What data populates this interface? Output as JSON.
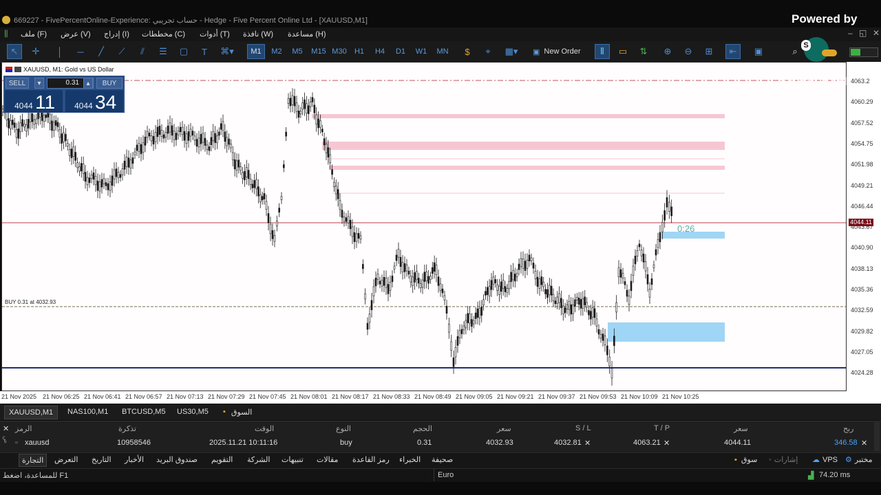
{
  "window": {
    "title": "669227 - FivePercentOnline-Experience: حساب تجريبي - Hedge - Five Percent Online Ltd - [XAUUSD,M1]",
    "overlay_powered": "Powered by",
    "overlay_brand": "StreamYard"
  },
  "menu": [
    {
      "label": "ملف (F)"
    },
    {
      "label": "عرض (V)"
    },
    {
      "label": "إدراج (I)"
    },
    {
      "label": "مخططات (C)"
    },
    {
      "label": "أدوات (T)"
    },
    {
      "label": "نافذة (W)"
    },
    {
      "label": "مساعدة (H)"
    }
  ],
  "toolbar": {
    "timeframes": [
      "M1",
      "M2",
      "M5",
      "M15",
      "M30",
      "H1",
      "H4",
      "D1",
      "W1",
      "MN"
    ],
    "selected_timeframe": "M1",
    "new_order": "New Order"
  },
  "chart": {
    "header": "XAUUSD, M1:  Gold vs US Dollar",
    "one_click": {
      "sell": "SELL",
      "buy": "BUY",
      "volume": "0.31",
      "sell_pre": "4044",
      "sell_big": "11",
      "buy_pre": "4044",
      "buy_big": "34"
    },
    "position_label": "BUY 0.31 at 4032.93",
    "countdown": "0:26",
    "current_price": "4044.11",
    "price_labels": [
      "4063.2",
      "4060.29",
      "4057.52",
      "4054.75",
      "4051.98",
      "4049.21",
      "4046.44",
      "4043.67",
      "4040.90",
      "4038.13",
      "4035.36",
      "4032.59",
      "4029.82",
      "4027.05",
      "4024.28"
    ],
    "time_labels": [
      "21 Nov 2025",
      "21 Nov 06:25",
      "21 Nov 06:41",
      "21 Nov 06:57",
      "21 Nov 07:13",
      "21 Nov 07:29",
      "21 Nov 07:45",
      "21 Nov 08:01",
      "21 Nov 08:17",
      "21 Nov 08:33",
      "21 Nov 08:49",
      "21 Nov 09:05",
      "21 Nov 09:21",
      "21 Nov 09:37",
      "21 Nov 09:53",
      "21 Nov 10:09",
      "21 Nov 10:25"
    ]
  },
  "symbol_tabs": [
    "XAUUSD,M1",
    "NAS100,M1",
    "BTCUSD,M5",
    "US30,M5",
    "السوق"
  ],
  "terminal": {
    "headers": {
      "symbol": "الرمز",
      "ticket": "تذكرة",
      "time": "الوقت",
      "type": "النوع",
      "volume": "الحجم",
      "price": "سعر",
      "sl": "S / L",
      "tp": "T / P",
      "price2": "سعر",
      "profit": "ربح"
    },
    "row": {
      "symbol": "xauusd",
      "ticket": "10958546",
      "time": "2025.11.21 10:11:16",
      "type": "buy",
      "volume": "0.31",
      "price": "4032.93",
      "sl": "4032.81",
      "tp": "4063.21",
      "price2": "4044.11",
      "profit": "346.58"
    }
  },
  "terminal_tabs": [
    "التجارة",
    "التعرض",
    "التاريخ",
    "الأخبار",
    "صندوق البريد",
    "التقويم",
    "الشركة",
    "تنبيهات",
    "مقالات",
    "رمز القاعدة",
    "الخبراء",
    "صحيفة"
  ],
  "terminal_right_tabs": [
    "سوق",
    "إشارات",
    "VPS",
    "مختبر"
  ],
  "status": {
    "help": "للمساعدة، اضغط F1",
    "profile": "Euro",
    "ping": "74.20 ms"
  }
}
